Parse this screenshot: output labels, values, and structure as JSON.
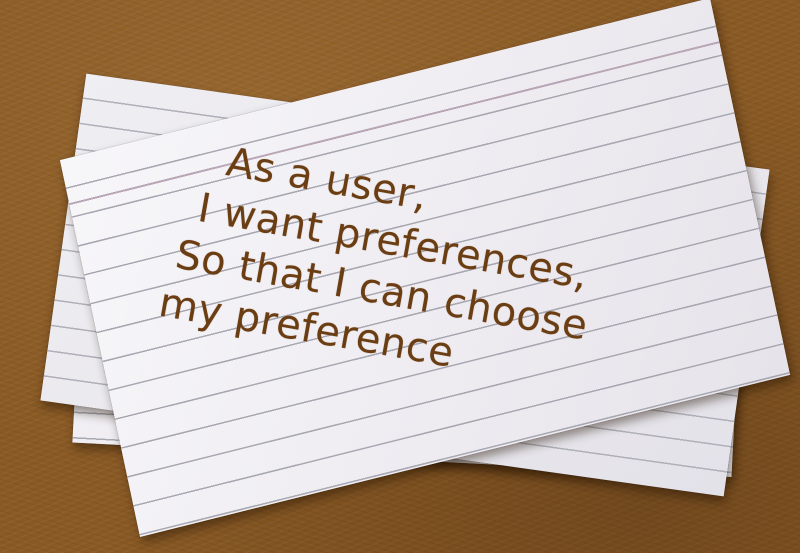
{
  "note": {
    "lines": [
      "As a user,",
      "I want preferences,",
      "So that I can choose",
      "my preference"
    ]
  },
  "colors": {
    "background": "#8a5a24",
    "card": "#f2f1f4",
    "rule_line": "#a8a8b2",
    "ink": "#6b3d12"
  }
}
